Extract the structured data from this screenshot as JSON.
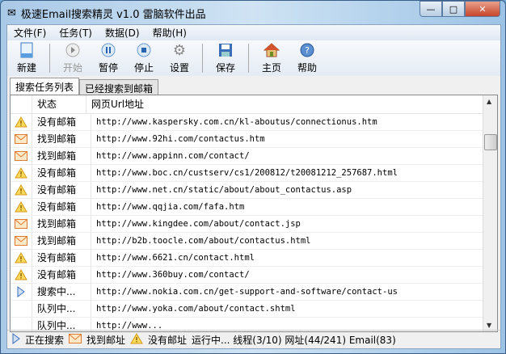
{
  "window": {
    "title": "极速Email搜索精灵 v1.0 雷脑软件出品",
    "minimize": "—",
    "maximize": "□",
    "close": "✕"
  },
  "menu": [
    "文件(F)",
    "任务(T)",
    "数据(D)",
    "帮助(H)"
  ],
  "toolbar": {
    "new": "新建",
    "start": "开始",
    "pause": "暂停",
    "stop": "停止",
    "settings": "设置",
    "save": "保存",
    "home": "主页",
    "help": "帮助"
  },
  "tabs": [
    "搜索任务列表",
    "已经搜索到邮箱"
  ],
  "columns": {
    "status": "状态",
    "url": "网页Url地址"
  },
  "rows": [
    {
      "icon": "warning",
      "status": "没有邮箱",
      "url": "http://www.kaspersky.com.cn/kl-aboutus/connectionus.htm"
    },
    {
      "icon": "mail",
      "status": "找到邮箱",
      "url": "http://www.92hi.com/contactus.htm"
    },
    {
      "icon": "mail",
      "status": "找到邮箱",
      "url": "http://www.appinn.com/contact/"
    },
    {
      "icon": "warning",
      "status": "没有邮箱",
      "url": "http://www.boc.cn/custserv/cs1/200812/t20081212_257687.html"
    },
    {
      "icon": "warning",
      "status": "没有邮箱",
      "url": "http://www.net.cn/static/about/about_contactus.asp"
    },
    {
      "icon": "warning",
      "status": "没有邮箱",
      "url": "http://www.qqjia.com/fafa.htm"
    },
    {
      "icon": "mail",
      "status": "找到邮箱",
      "url": "http://www.kingdee.com/about/contact.jsp"
    },
    {
      "icon": "mail",
      "status": "找到邮箱",
      "url": "http://b2b.toocle.com/about/contactus.html"
    },
    {
      "icon": "warning",
      "status": "没有邮箱",
      "url": "http://www.6621.cn/contact.html"
    },
    {
      "icon": "warning",
      "status": "没有邮箱",
      "url": "http://www.360buy.com/contact/"
    },
    {
      "icon": "play",
      "status": "搜索中...",
      "url": "http://www.nokia.com.cn/get-support-and-software/contact-us"
    },
    {
      "icon": "none",
      "status": "队列中...",
      "url": "http://www.yoka.com/about/contact.shtml"
    },
    {
      "icon": "none",
      "status": "队列中...",
      "url": "http://www..."
    }
  ],
  "statusbar": {
    "searching": "正在搜索",
    "found": "找到邮址",
    "notfound": "没有邮址",
    "summary": "运行中... 线程(3/10) 网址(44/241) Email(83)"
  }
}
